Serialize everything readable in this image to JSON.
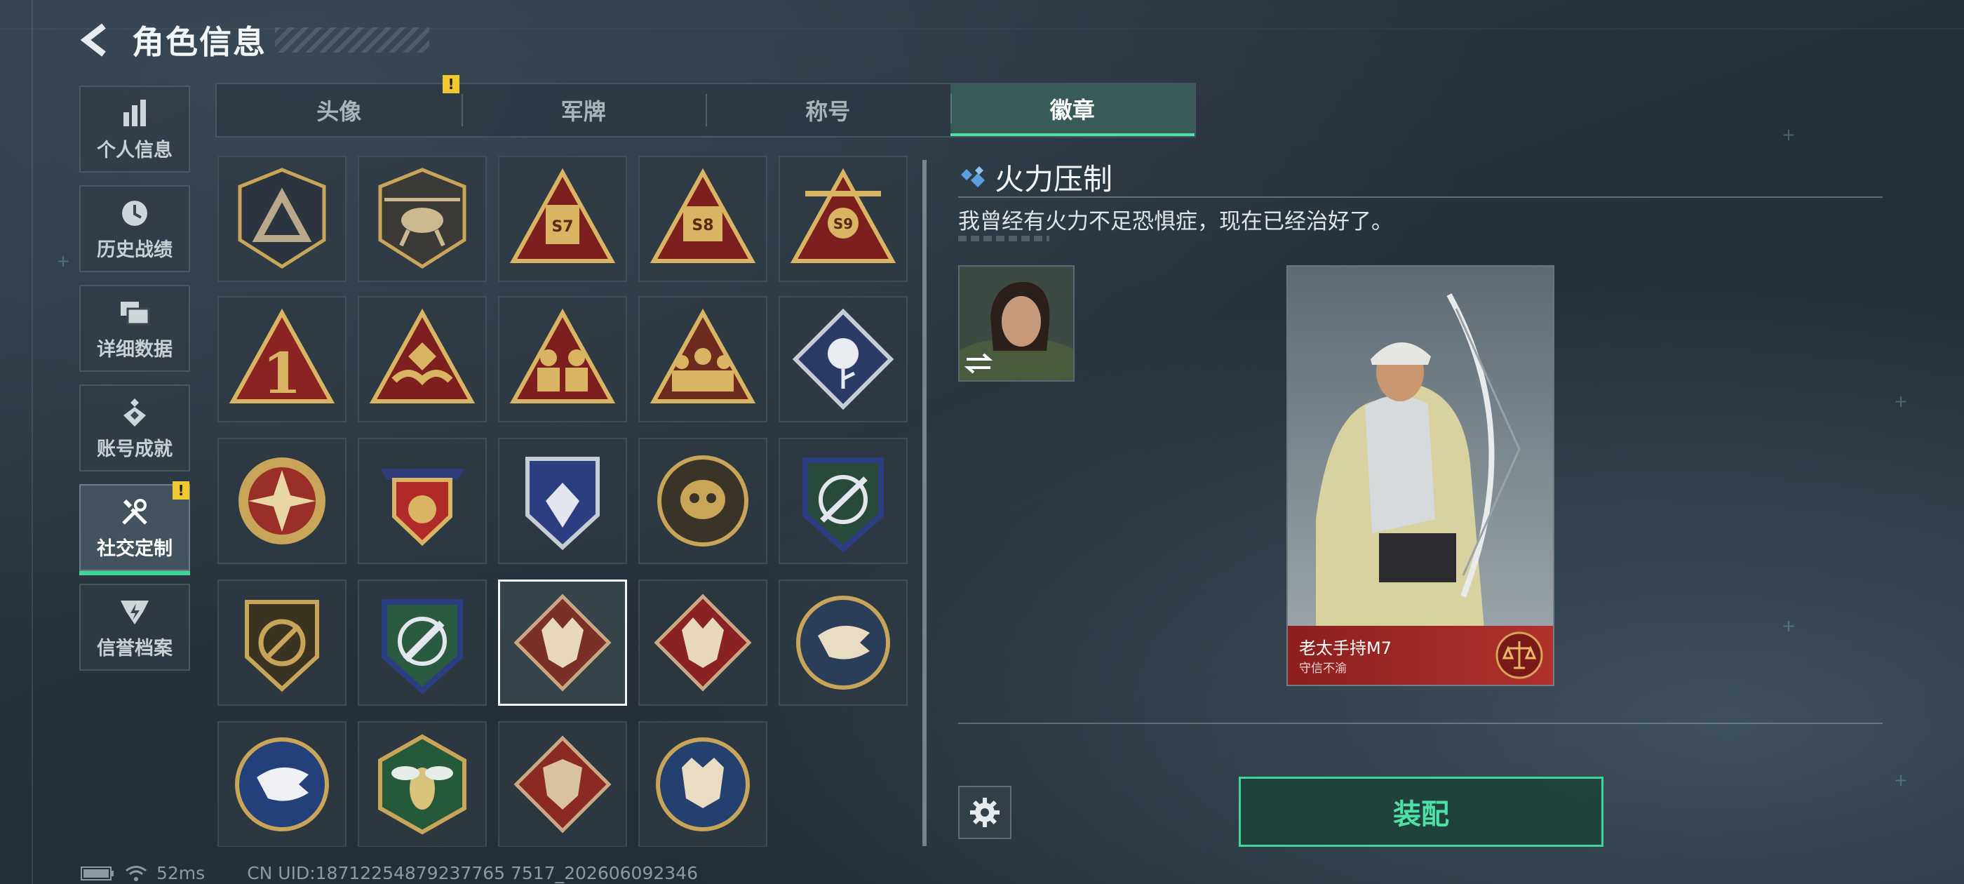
{
  "header": {
    "title": "角色信息"
  },
  "nav": [
    {
      "label": "个人信息",
      "icon": "bar-chart-icon"
    },
    {
      "label": "历史战绩",
      "icon": "clock-icon"
    },
    {
      "label": "详细数据",
      "icon": "folders-icon"
    },
    {
      "label": "账号成就",
      "icon": "achievement-icon"
    },
    {
      "label": "社交定制",
      "icon": "tools-icon",
      "active": true,
      "alert": "!"
    },
    {
      "label": "信誉档案",
      "icon": "credit-shield-icon"
    }
  ],
  "tabs": [
    {
      "label": "头像",
      "alert": "!"
    },
    {
      "label": "军牌"
    },
    {
      "label": "称号"
    },
    {
      "label": "徽章",
      "active": true
    }
  ],
  "badges": [
    {
      "icon": "triangle-shield-badge-icon"
    },
    {
      "icon": "helicopter-badge-icon"
    },
    {
      "icon": "s7-triangle-badge-icon",
      "text": "S7"
    },
    {
      "icon": "s8-triangle-badge-icon",
      "text": "S8"
    },
    {
      "icon": "s9-triangle-badge-icon",
      "text": "S9"
    },
    {
      "icon": "number-one-triangle-badge-icon",
      "text": "1"
    },
    {
      "icon": "hands-triangle-badge-icon"
    },
    {
      "icon": "soldiers-triangle-badge-icon"
    },
    {
      "icon": "team-triangle-badge-icon"
    },
    {
      "icon": "rose-diamond-badge-icon"
    },
    {
      "icon": "star-compass-badge-icon"
    },
    {
      "icon": "crest-ribbon-badge-icon"
    },
    {
      "icon": "blue-stars-shield-badge-icon"
    },
    {
      "icon": "skull-medal-badge-icon"
    },
    {
      "icon": "crosshair-rifle-shield-badge-icon"
    },
    {
      "icon": "no-gun-shield-badge-icon"
    },
    {
      "icon": "knife-shield-badge-icon"
    },
    {
      "icon": "wolf-diamond-badge-icon",
      "selected": true
    },
    {
      "icon": "wolf-red-diamond-badge-icon"
    },
    {
      "icon": "eagle-round-badge-icon"
    },
    {
      "icon": "eagle-blue-round-badge-icon"
    },
    {
      "icon": "wasp-hexagon-badge-icon"
    },
    {
      "icon": "dragon-diamond-badge-icon"
    },
    {
      "icon": "lynx-round-badge-icon"
    }
  ],
  "detail": {
    "title": "火力压制",
    "description": "我曾经有火力不足恐惧症，现在已经治好了。",
    "character_name": "老太手持M7",
    "character_subtitle": "守信不渝",
    "equip_label": "装配"
  },
  "status": {
    "ping": "52ms",
    "uid": "CN UID:18712254879237765 7517_202606092346"
  },
  "colors": {
    "accent": "#3fd49a",
    "alert": "#f1c830",
    "card_red": "#b0322d",
    "badge_gold": "#c9a55a"
  }
}
